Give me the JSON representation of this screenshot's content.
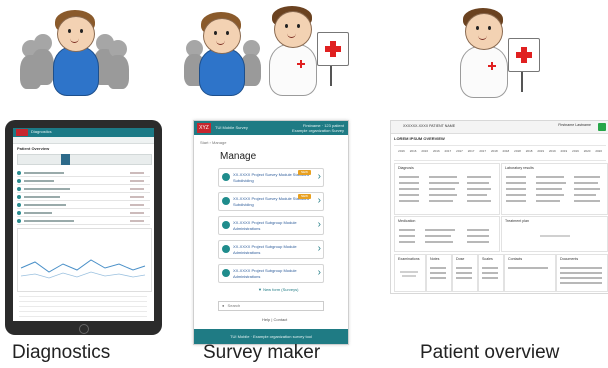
{
  "captions": {
    "diagnostics": "Diagnostics",
    "survey_maker": "Survey maker",
    "patient_overview": "Patient overview"
  },
  "survey": {
    "brand": "XYZ",
    "app_name": "TUI Mobile Survey",
    "header_right_1": "Firstname · 123 patient",
    "header_right_2": "Example organization Survey",
    "breadcrumb": "Start › Manage",
    "title": "Manage",
    "cards": [
      {
        "line1": "XX-XXXX Project Survey Module Standard",
        "line2": "Subdividing",
        "tag": "NEW"
      },
      {
        "line1": "XX-XXXX Project Survey Module Standard",
        "line2": "Subdividing",
        "tag": "NEW"
      },
      {
        "line1": "XX-XXXX Project Subgroup Module",
        "line2": "Administrations",
        "tag": ""
      },
      {
        "line1": "XX-XXXX Project Subgroup Module",
        "line2": "Administrations",
        "tag": ""
      },
      {
        "line1": "XX-XXXX Project Subgroup Module",
        "line2": "Administrations",
        "tag": ""
      }
    ],
    "new_survey_link": "▼ New form (Surveys)",
    "search_placeholder": "Search",
    "footer_links": "Help  |  Contact",
    "bottom_bar": "TUI Mobile · Example organization survey tool"
  },
  "tablet": {
    "header_title": "Diagnostics",
    "section_label": "Patient Overview"
  },
  "overview": {
    "patient_id": "XXXXXX-XXXX  PATIENT NAME",
    "user": "Firstname Lastname",
    "title": "LOREM IPSUM OVERVIEW",
    "timeline_ticks": [
      "2016",
      "2016",
      "2016",
      "2016",
      "2017",
      "2017",
      "2017",
      "2017",
      "2018",
      "2018",
      "2018",
      "2018",
      "2019",
      "2019",
      "2019",
      "2019",
      "2020",
      "2020"
    ],
    "panels": [
      "Diagnosis",
      "Laboratory results",
      "Medication",
      "Treatment plan",
      "Examinations",
      "Notes",
      "Dose",
      "Scales",
      "Contacts",
      "Documents"
    ]
  }
}
